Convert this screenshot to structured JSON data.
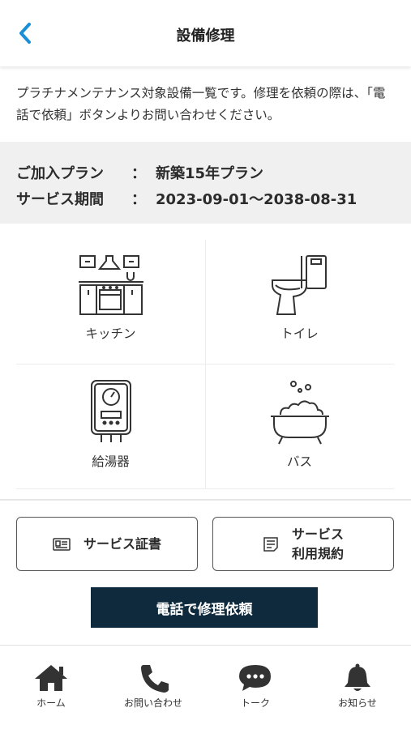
{
  "header": {
    "title": "設備修理"
  },
  "intro": {
    "text": "プラチナメンテナンス対象設備一覧です。修理を依頼の際は、「電話で依頼」ボタンよりお問い合わせください。"
  },
  "plan": {
    "plan_label": "ご加入プラン",
    "plan_value": "新築15年プラン",
    "period_label": "サービス期間",
    "period_value": "2023-09-01〜2038-08-31",
    "colon": "："
  },
  "equipment": [
    {
      "label": "キッチン",
      "icon": "kitchen-icon"
    },
    {
      "label": "トイレ",
      "icon": "toilet-icon"
    },
    {
      "label": "給湯器",
      "icon": "water-heater-icon"
    },
    {
      "label": "バス",
      "icon": "bathtub-icon"
    }
  ],
  "buttons": {
    "certificate": "サービス証書",
    "terms_line1": "サービス",
    "terms_line2": "利用規約",
    "call_repair": "電話で修理依頼"
  },
  "tabs": [
    {
      "label": "ホーム",
      "icon": "home-icon"
    },
    {
      "label": "お問い合わせ",
      "icon": "phone-icon"
    },
    {
      "label": "トーク",
      "icon": "chat-icon"
    },
    {
      "label": "お知らせ",
      "icon": "bell-icon"
    }
  ],
  "colors": {
    "accent": "#1a8fd8",
    "primary": "#0f2a3d",
    "plan_bg": "#f0f0f0"
  }
}
